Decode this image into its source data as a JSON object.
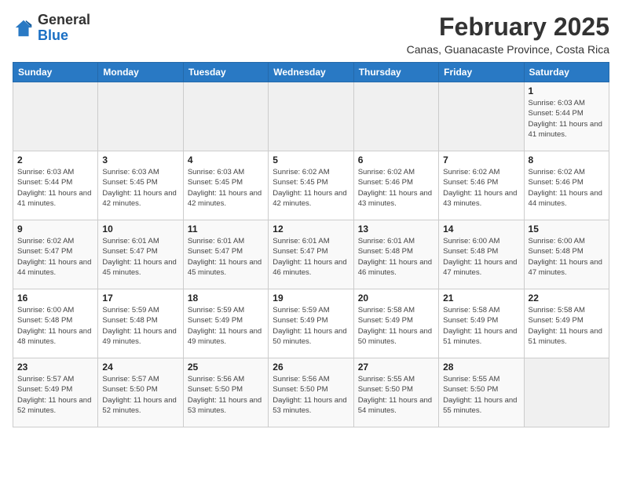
{
  "logo": {
    "general": "General",
    "blue": "Blue"
  },
  "title": {
    "month_year": "February 2025",
    "location": "Canas, Guanacaste Province, Costa Rica"
  },
  "weekdays": [
    "Sunday",
    "Monday",
    "Tuesday",
    "Wednesday",
    "Thursday",
    "Friday",
    "Saturday"
  ],
  "weeks": [
    [
      {
        "day": "",
        "sunrise": "",
        "sunset": "",
        "daylight": ""
      },
      {
        "day": "",
        "sunrise": "",
        "sunset": "",
        "daylight": ""
      },
      {
        "day": "",
        "sunrise": "",
        "sunset": "",
        "daylight": ""
      },
      {
        "day": "",
        "sunrise": "",
        "sunset": "",
        "daylight": ""
      },
      {
        "day": "",
        "sunrise": "",
        "sunset": "",
        "daylight": ""
      },
      {
        "day": "",
        "sunrise": "",
        "sunset": "",
        "daylight": ""
      },
      {
        "day": "1",
        "sunrise": "Sunrise: 6:03 AM",
        "sunset": "Sunset: 5:44 PM",
        "daylight": "Daylight: 11 hours and 41 minutes."
      }
    ],
    [
      {
        "day": "2",
        "sunrise": "Sunrise: 6:03 AM",
        "sunset": "Sunset: 5:44 PM",
        "daylight": "Daylight: 11 hours and 41 minutes."
      },
      {
        "day": "3",
        "sunrise": "Sunrise: 6:03 AM",
        "sunset": "Sunset: 5:45 PM",
        "daylight": "Daylight: 11 hours and 42 minutes."
      },
      {
        "day": "4",
        "sunrise": "Sunrise: 6:03 AM",
        "sunset": "Sunset: 5:45 PM",
        "daylight": "Daylight: 11 hours and 42 minutes."
      },
      {
        "day": "5",
        "sunrise": "Sunrise: 6:02 AM",
        "sunset": "Sunset: 5:45 PM",
        "daylight": "Daylight: 11 hours and 42 minutes."
      },
      {
        "day": "6",
        "sunrise": "Sunrise: 6:02 AM",
        "sunset": "Sunset: 5:46 PM",
        "daylight": "Daylight: 11 hours and 43 minutes."
      },
      {
        "day": "7",
        "sunrise": "Sunrise: 6:02 AM",
        "sunset": "Sunset: 5:46 PM",
        "daylight": "Daylight: 11 hours and 43 minutes."
      },
      {
        "day": "8",
        "sunrise": "Sunrise: 6:02 AM",
        "sunset": "Sunset: 5:46 PM",
        "daylight": "Daylight: 11 hours and 44 minutes."
      }
    ],
    [
      {
        "day": "9",
        "sunrise": "Sunrise: 6:02 AM",
        "sunset": "Sunset: 5:47 PM",
        "daylight": "Daylight: 11 hours and 44 minutes."
      },
      {
        "day": "10",
        "sunrise": "Sunrise: 6:01 AM",
        "sunset": "Sunset: 5:47 PM",
        "daylight": "Daylight: 11 hours and 45 minutes."
      },
      {
        "day": "11",
        "sunrise": "Sunrise: 6:01 AM",
        "sunset": "Sunset: 5:47 PM",
        "daylight": "Daylight: 11 hours and 45 minutes."
      },
      {
        "day": "12",
        "sunrise": "Sunrise: 6:01 AM",
        "sunset": "Sunset: 5:47 PM",
        "daylight": "Daylight: 11 hours and 46 minutes."
      },
      {
        "day": "13",
        "sunrise": "Sunrise: 6:01 AM",
        "sunset": "Sunset: 5:48 PM",
        "daylight": "Daylight: 11 hours and 46 minutes."
      },
      {
        "day": "14",
        "sunrise": "Sunrise: 6:00 AM",
        "sunset": "Sunset: 5:48 PM",
        "daylight": "Daylight: 11 hours and 47 minutes."
      },
      {
        "day": "15",
        "sunrise": "Sunrise: 6:00 AM",
        "sunset": "Sunset: 5:48 PM",
        "daylight": "Daylight: 11 hours and 47 minutes."
      }
    ],
    [
      {
        "day": "16",
        "sunrise": "Sunrise: 6:00 AM",
        "sunset": "Sunset: 5:48 PM",
        "daylight": "Daylight: 11 hours and 48 minutes."
      },
      {
        "day": "17",
        "sunrise": "Sunrise: 5:59 AM",
        "sunset": "Sunset: 5:48 PM",
        "daylight": "Daylight: 11 hours and 49 minutes."
      },
      {
        "day": "18",
        "sunrise": "Sunrise: 5:59 AM",
        "sunset": "Sunset: 5:49 PM",
        "daylight": "Daylight: 11 hours and 49 minutes."
      },
      {
        "day": "19",
        "sunrise": "Sunrise: 5:59 AM",
        "sunset": "Sunset: 5:49 PM",
        "daylight": "Daylight: 11 hours and 50 minutes."
      },
      {
        "day": "20",
        "sunrise": "Sunrise: 5:58 AM",
        "sunset": "Sunset: 5:49 PM",
        "daylight": "Daylight: 11 hours and 50 minutes."
      },
      {
        "day": "21",
        "sunrise": "Sunrise: 5:58 AM",
        "sunset": "Sunset: 5:49 PM",
        "daylight": "Daylight: 11 hours and 51 minutes."
      },
      {
        "day": "22",
        "sunrise": "Sunrise: 5:58 AM",
        "sunset": "Sunset: 5:49 PM",
        "daylight": "Daylight: 11 hours and 51 minutes."
      }
    ],
    [
      {
        "day": "23",
        "sunrise": "Sunrise: 5:57 AM",
        "sunset": "Sunset: 5:49 PM",
        "daylight": "Daylight: 11 hours and 52 minutes."
      },
      {
        "day": "24",
        "sunrise": "Sunrise: 5:57 AM",
        "sunset": "Sunset: 5:50 PM",
        "daylight": "Daylight: 11 hours and 52 minutes."
      },
      {
        "day": "25",
        "sunrise": "Sunrise: 5:56 AM",
        "sunset": "Sunset: 5:50 PM",
        "daylight": "Daylight: 11 hours and 53 minutes."
      },
      {
        "day": "26",
        "sunrise": "Sunrise: 5:56 AM",
        "sunset": "Sunset: 5:50 PM",
        "daylight": "Daylight: 11 hours and 53 minutes."
      },
      {
        "day": "27",
        "sunrise": "Sunrise: 5:55 AM",
        "sunset": "Sunset: 5:50 PM",
        "daylight": "Daylight: 11 hours and 54 minutes."
      },
      {
        "day": "28",
        "sunrise": "Sunrise: 5:55 AM",
        "sunset": "Sunset: 5:50 PM",
        "daylight": "Daylight: 11 hours and 55 minutes."
      },
      {
        "day": "",
        "sunrise": "",
        "sunset": "",
        "daylight": ""
      }
    ]
  ]
}
